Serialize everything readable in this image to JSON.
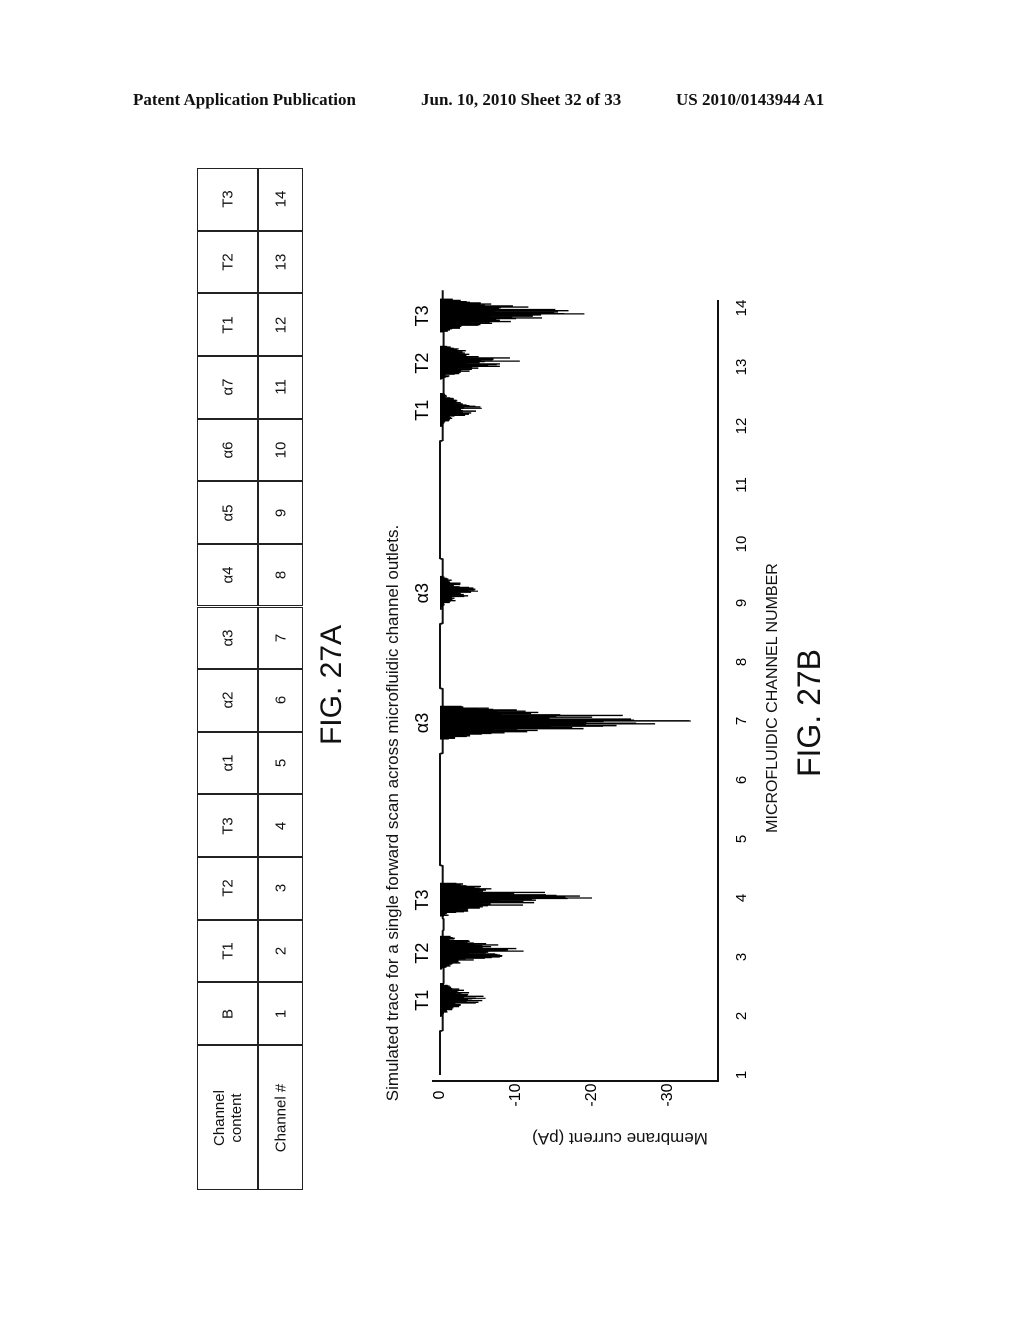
{
  "header": {
    "publication": "Patent Application Publication",
    "date_sheet": "Jun. 10, 2010  Sheet 32 of 33",
    "patent_number": "US 2010/0143944 A1"
  },
  "fig27a": {
    "caption": "FIG. 27A",
    "row_headers": [
      "Channel content",
      "Channel #"
    ],
    "columns": [
      {
        "content": "B",
        "number": "1"
      },
      {
        "content": "T1",
        "number": "2"
      },
      {
        "content": "T2",
        "number": "3"
      },
      {
        "content": "T3",
        "number": "4"
      },
      {
        "content": "α1",
        "number": "5"
      },
      {
        "content": "α2",
        "number": "6"
      },
      {
        "content": "α3",
        "number": "7"
      },
      {
        "content": "α4",
        "number": "8"
      },
      {
        "content": "α5",
        "number": "9"
      },
      {
        "content": "α6",
        "number": "10"
      },
      {
        "content": "α7",
        "number": "11"
      },
      {
        "content": "T1",
        "number": "12"
      },
      {
        "content": "T2",
        "number": "13"
      },
      {
        "content": "T3",
        "number": "14"
      }
    ]
  },
  "fig27b": {
    "caption": "FIG. 27B"
  },
  "chart_data": {
    "type": "line",
    "title": "Simulated trace for a single forward scan across microfluidic channel outlets.",
    "xlabel": "MICROFLUIDIC CHANNEL NUMBER",
    "ylabel": "Membrane current (pA)",
    "xlim": [
      1,
      14
    ],
    "ylim": [
      0,
      -35
    ],
    "x_ticks": [
      "1",
      "2",
      "3",
      "4",
      "5",
      "6",
      "7",
      "8",
      "9",
      "10",
      "11",
      "12",
      "13",
      "14"
    ],
    "y_ticks": [
      "0",
      "-10",
      "-20",
      "-30"
    ],
    "grid": false,
    "orientation": "rotated -90 degrees on page",
    "peaks": [
      {
        "label": "T1",
        "channel": 2.3,
        "min_current": -6
      },
      {
        "label": "T2",
        "channel": 3.1,
        "min_current": -11
      },
      {
        "label": "T3",
        "channel": 4.0,
        "min_current": -20
      },
      {
        "label": "α3",
        "channel": 7.0,
        "min_current": -33
      },
      {
        "label": "α3",
        "channel": 9.2,
        "min_current": -5
      },
      {
        "label": "T1",
        "channel": 12.3,
        "min_current": -5.5
      },
      {
        "label": "T2",
        "channel": 13.1,
        "min_current": -10.5
      },
      {
        "label": "T3",
        "channel": 13.9,
        "min_current": -19
      }
    ],
    "baseline_current": 0
  }
}
